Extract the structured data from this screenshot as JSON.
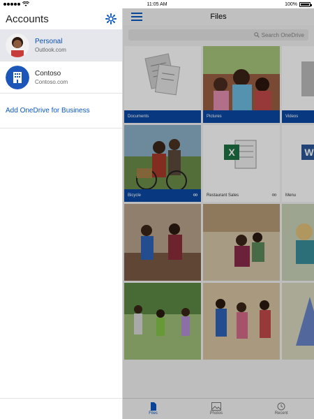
{
  "status_bar": {
    "time": "11:05 AM",
    "battery": "100%",
    "battery_level": 1.0
  },
  "sidebar": {
    "title": "Accounts",
    "accounts": [
      {
        "name": "Personal",
        "subtitle": "Outlook.com",
        "selected": true,
        "icon": "avatar-photo"
      },
      {
        "name": "Contoso",
        "subtitle": "Contoso.com",
        "selected": false,
        "icon": "building-icon"
      }
    ],
    "add_business": "Add OneDrive for Business"
  },
  "files": {
    "title": "Files",
    "search_placeholder": "Search OneDrive",
    "tiles": [
      {
        "name": "Documents",
        "kind": "folder"
      },
      {
        "name": "Pictures",
        "kind": "folder"
      },
      {
        "name": "Videos",
        "kind": "folder"
      },
      {
        "name": "Bicycle",
        "kind": "photo-shared"
      },
      {
        "name": "Restaurant Sales",
        "kind": "excel-shared"
      },
      {
        "name": "Menu",
        "kind": "word"
      }
    ]
  },
  "bottom_tabs": [
    {
      "label": "Files",
      "icon": "file-icon",
      "active": true
    },
    {
      "label": "Photos",
      "icon": "photo-icon",
      "active": false
    },
    {
      "label": "Recent",
      "icon": "clock-icon",
      "active": false
    }
  ],
  "colors": {
    "accent": "#0a56c2",
    "tile_bar": "#0b4aa5",
    "selected_row": "#e6e7ed"
  }
}
